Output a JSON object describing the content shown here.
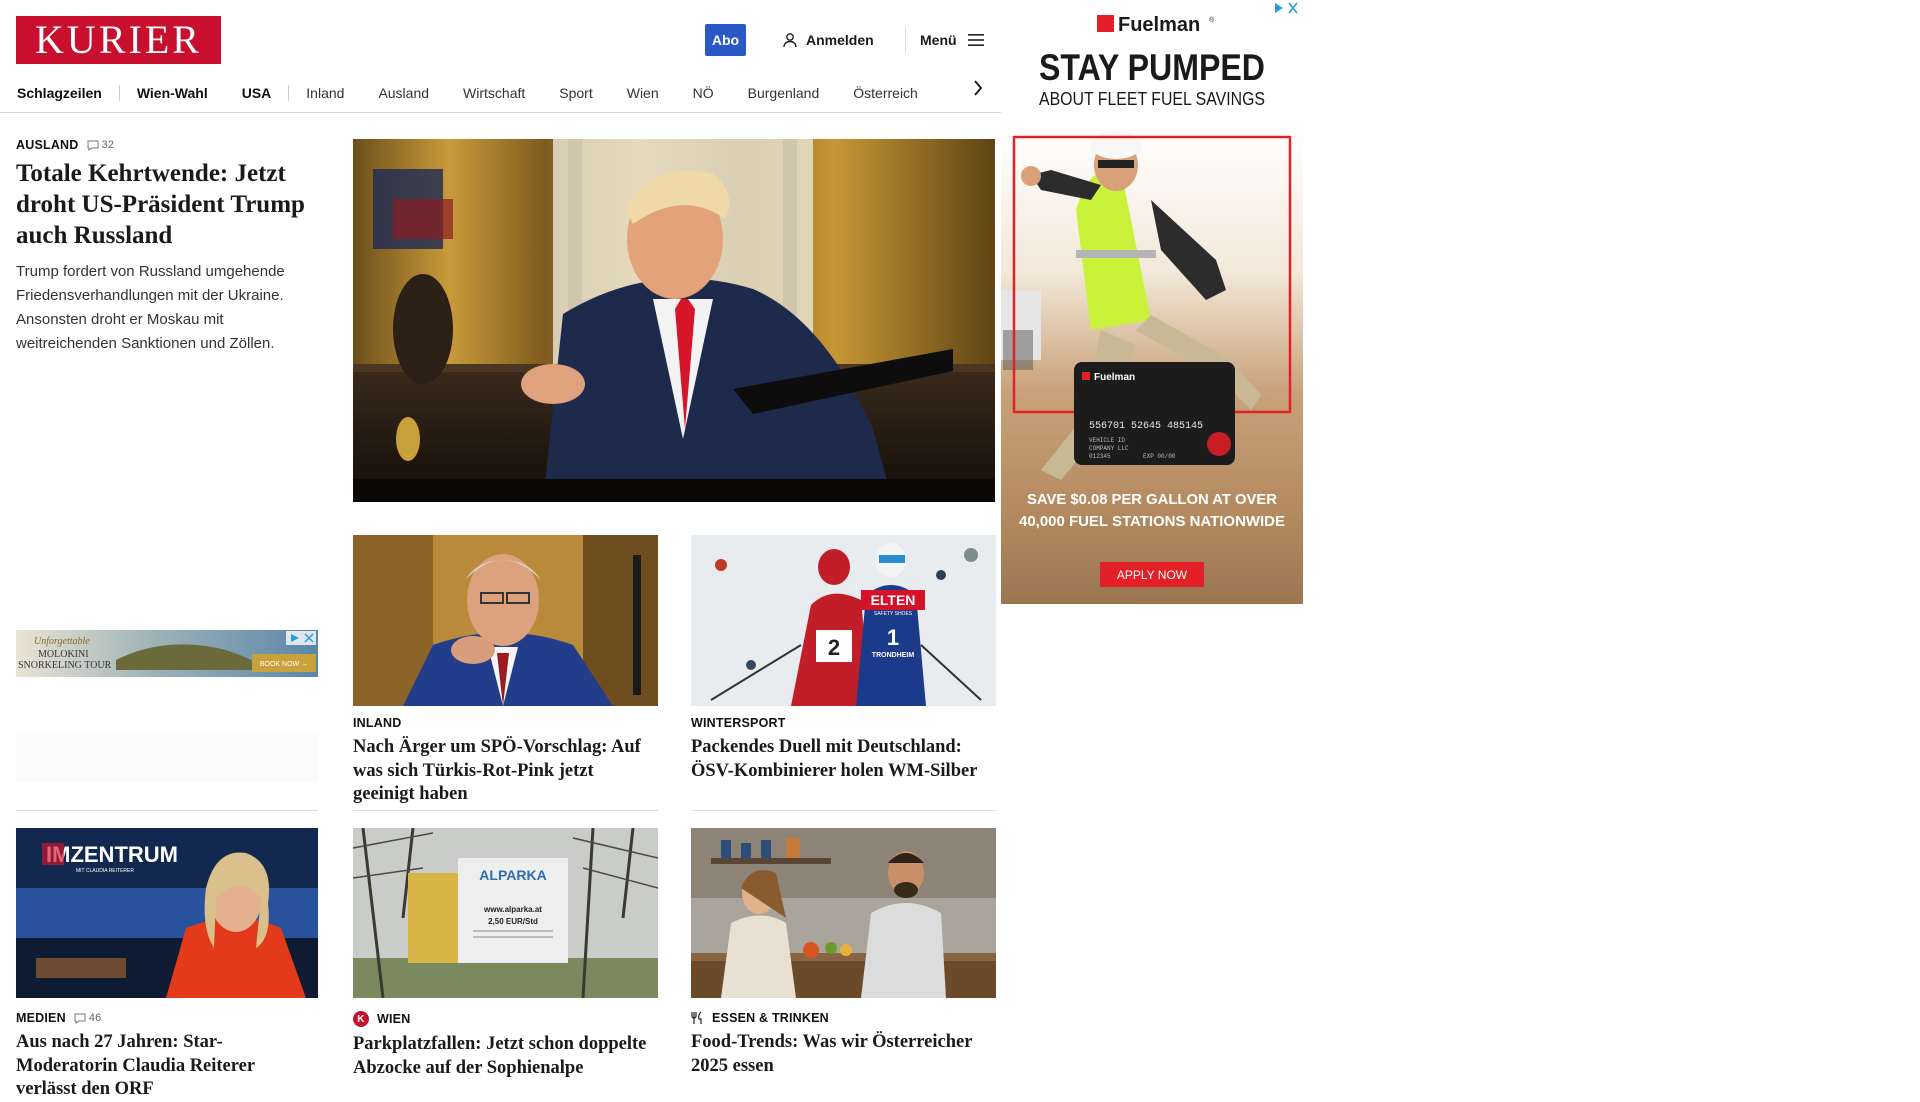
{
  "header": {
    "logo": "KURIER",
    "abo": "Abo",
    "login": "Anmelden",
    "menu": "Menü"
  },
  "nav": {
    "items": [
      "Schlagzeilen",
      "Wien-Wahl",
      "USA",
      "Inland",
      "Ausland",
      "Wirtschaft",
      "Sport",
      "Wien",
      "NÖ",
      "Burgenland",
      "Österreich"
    ]
  },
  "lead": {
    "category": "AUSLAND",
    "comments": "32",
    "headline": "Totale Kehrtwende: Jetzt droht US-Präsident Trump auch Russland",
    "teaser": "Trump fordert von Russland umgehende Friedensverhandlungen mit der Ukraine. Ansonsten droht er Moskau mit weitreichenden Sanktionen und Zöllen."
  },
  "cards": [
    {
      "category": "INLAND",
      "headline": "Nach Ärger um SPÖ-Vorschlag: Auf was sich Türkis-Rot-Pink jetzt geeinigt haben"
    },
    {
      "category": "WINTERSPORT",
      "headline": "Packendes Duell mit Deutschland: ÖSV-Kombinierer holen WM-Silber"
    },
    {
      "category": "MEDIEN",
      "comments": "46",
      "headline": "Aus nach 27 Jahren: Star-Moderatorin Claudia Reiterer verlässt den ORF"
    },
    {
      "category": "WIEN",
      "badge": "K",
      "headline": "Parkplatzfallen: Jetzt schon doppelte Abzocke auf der Sophienalpe"
    },
    {
      "category": "ESSEN & TRINKEN",
      "headline": "Food-Trends: Was wir Österreicher 2025 essen"
    }
  ],
  "small_ad": {
    "line1": "Unforgettable",
    "line2": "MOLOKINI",
    "line3": "SNORKELING TOUR",
    "cta": "BOOK NOW →"
  },
  "image_text": {
    "imzentrum": "IMZENTRUM",
    "imzentrum_sub": "MIT CLAUDIA REITERER",
    "sign_brand": "ALPARKA",
    "sign_url": "www.alparka.at",
    "sign_price": "2,50 EUR/Std",
    "bib1": "2",
    "bib2": "1",
    "bib_sponsor": "ELTEN",
    "bib_sponsor_sub": "SAFETY SHOES",
    "bib_city": "TRONDHEIM",
    "card_brand": "Fuelman",
    "card_number": "556701 52645 485145",
    "card_line1": "VEHICLE ID",
    "card_line2": "COMPANY LLC",
    "card_line3": "012345",
    "card_exp": "EXP 00/00"
  },
  "big_ad": {
    "brand": "Fuelman",
    "brand_mark": "®",
    "headline1": "STAY PUMPED",
    "headline2": "ABOUT FLEET FUEL SAVINGS",
    "savings1": "SAVE $0.08 PER GALLON AT OVER",
    "savings2": "40,000 FUEL STATIONS NATIONWIDE",
    "cta": "APPLY NOW"
  },
  "colors": {
    "brand_red": "#c8102e",
    "abo_blue": "#2a59c7",
    "ad_red": "#e32027"
  }
}
